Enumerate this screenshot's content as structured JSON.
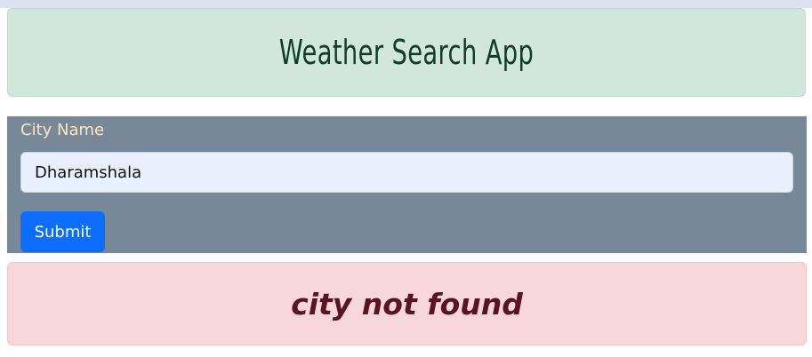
{
  "header": {
    "title": "Weather Search App"
  },
  "form": {
    "city_label": "City Name",
    "city_value": "Dharamshala",
    "submit_label": "Submit"
  },
  "result": {
    "message": "city not found"
  },
  "colors": {
    "header_bg": "#d1e7dd",
    "form_bg": "#778899",
    "label_color": "#ffe4c4",
    "button_bg": "#0d6efd",
    "error_bg": "#f8d7da",
    "error_text": "#5a1420"
  }
}
